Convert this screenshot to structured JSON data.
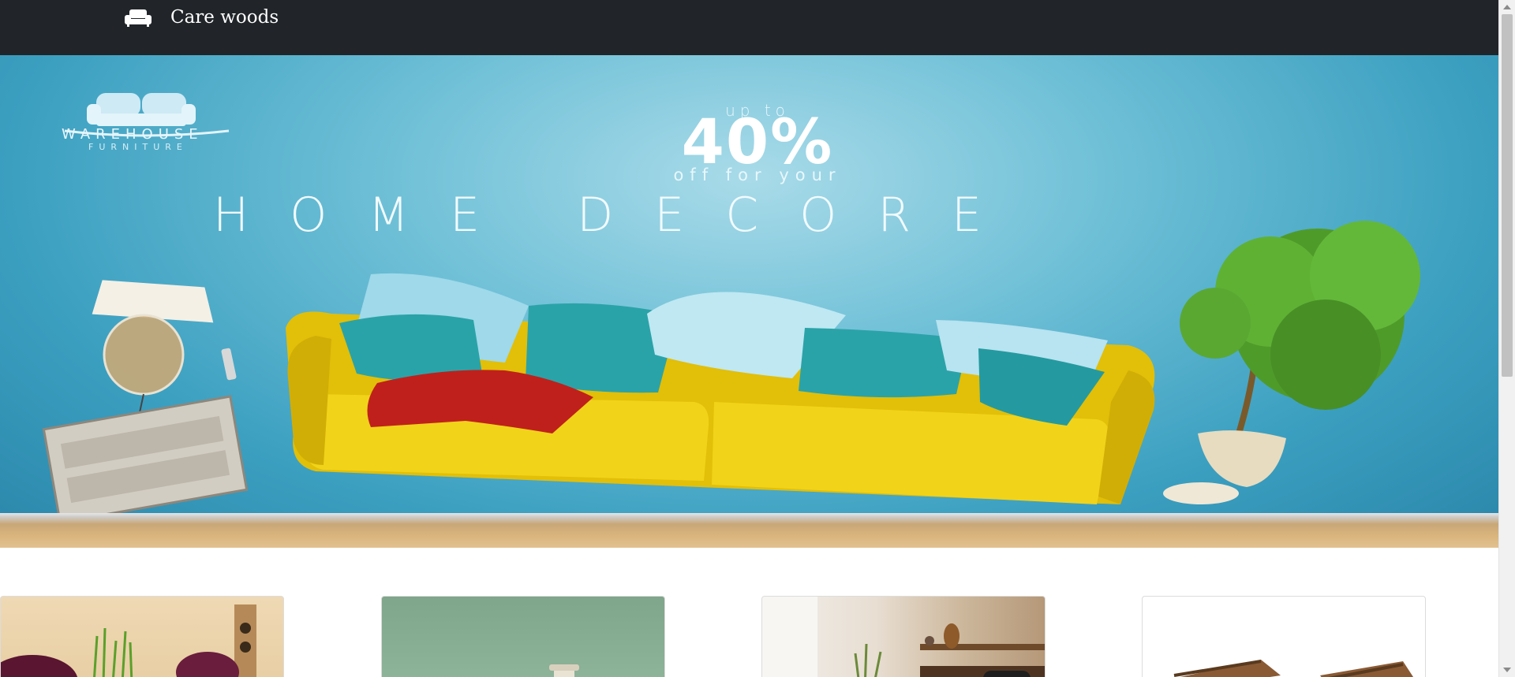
{
  "navbar": {
    "brand_icon": "sofa-icon",
    "brand_name": "Care woods"
  },
  "hero": {
    "logo_icon": "sofa-logo-icon",
    "logo_title": "WAREHOUSE",
    "logo_subtitle": "FURNITURE",
    "promo_upto": "up to",
    "promo_percent": "40%",
    "promo_off": "off for your",
    "promo_headline": "HOME DECORE",
    "colors": {
      "wall": "#3b9fc0",
      "sofa": "#e8c90e",
      "pillow_teal": "#2aa3a8",
      "pillow_light": "#bfe8f3",
      "blanket": "#c0201c",
      "plant": "#4f9b2a"
    }
  },
  "categories": [
    {
      "name": "chairs-card",
      "image": "purple-chairs-photo"
    },
    {
      "name": "decor-card",
      "image": "green-wall-vase-photo"
    },
    {
      "name": "living-room-card",
      "image": "living-room-shelf-photo"
    },
    {
      "name": "wooden-bench-card",
      "image": "wooden-bench-photo"
    }
  ]
}
